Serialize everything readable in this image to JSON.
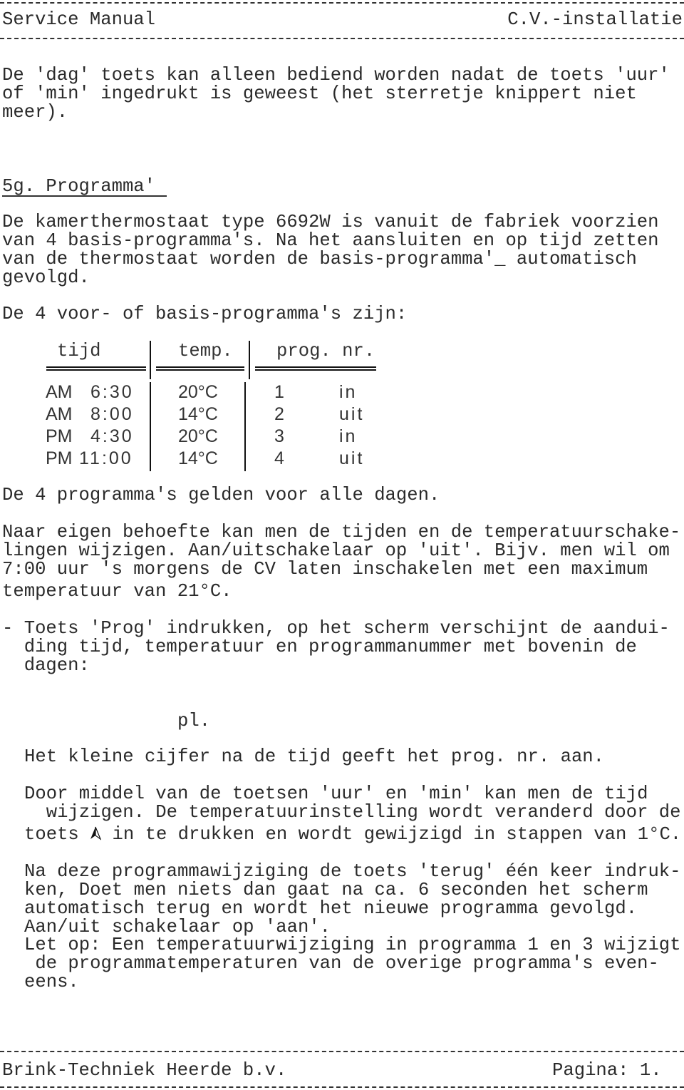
{
  "header": {
    "left": "Service Manual",
    "right": "C.V.-installatie"
  },
  "intro": {
    "lines": [
      "De 'dag' toets kan alleen bediend worden nadat de toets 'uur'",
      "of 'min' ingedrukt is geweest (het sterretje knippert niet",
      "meer)."
    ]
  },
  "section": {
    "heading": "5g. Programma'",
    "para1": [
      "De kamerthermostaat type 6692W is vanuit de fabriek voorzien",
      "van 4 basis-programma's. Na het aansluiten en op tijd zetten",
      "van de thermostaat worden de basis-programma'_ automatisch",
      "gevolgd."
    ],
    "table_intro": "De 4 voor- of basis-programma's zijn:"
  },
  "table": {
    "headers": [
      "tijd",
      "temp.",
      "prog. nr."
    ],
    "rows": [
      {
        "ampm": "AM",
        "time": "6:30",
        "temp": "20°C",
        "prog": "1",
        "mode": "in"
      },
      {
        "ampm": "AM",
        "time": "8:00",
        "temp": "14°C",
        "prog": "2",
        "mode": "uit"
      },
      {
        "ampm": "PM",
        "time": "4:30",
        "temp": "20°C",
        "prog": "3",
        "mode": "in"
      },
      {
        "ampm": "PM",
        "time": "11:00",
        "temp": "14°C",
        "prog": "4",
        "mode": "uit"
      }
    ]
  },
  "body": {
    "all_days": "De 4 programma's gelden voor alle dagen.",
    "para2": [
      "Naar eigen behoefte kan men de tijden en de temperatuurschake-",
      "lingen wijzigen. Aan/uitschakelaar op 'uit'. Bijv. men wil om",
      "7:00 uur 's morgens de CV laten inschakelen met een maximum",
      "temperatuur van 21°C."
    ],
    "step1": [
      "- Toets 'Prog' indrukken, op het scherm verschijnt de aandui-",
      "  ding tijd, temperatuur en programmanummer met bovenin de",
      "  dagen:"
    ],
    "pl": "pl.",
    "small_digit": "Het kleine cijfer na de tijd geeft het prog. nr. aan.",
    "para3": [
      "Door middel van de toetsen 'uur' en 'min' kan men de tijd",
      "  wijzigen. De temperatuurinstelling wordt veranderd door de"
    ],
    "para3_last_before": "toets ",
    "para3_icon": "up-arrow-icon",
    "para3_last_after": " in te drukken en wordt gewijzigd in stappen van 1°C.",
    "para4": [
      "Na deze programmawijziging de toets 'terug' één keer indruk-",
      "ken, Doet men niets dan gaat na ca. 6 seconden het scherm",
      "automatisch terug en wordt het nieuwe programma gevolgd.",
      "Aan/uit schakelaar op 'aan'.",
      "Let op: Een temperatuurwijziging in programma 1 en 3 wijzigt",
      " de programmatemperaturen van de overige programma's even-",
      "eens."
    ]
  },
  "footer": {
    "left": "Brink-Techniek Heerde b.v.",
    "right": "Pagina: 1."
  }
}
